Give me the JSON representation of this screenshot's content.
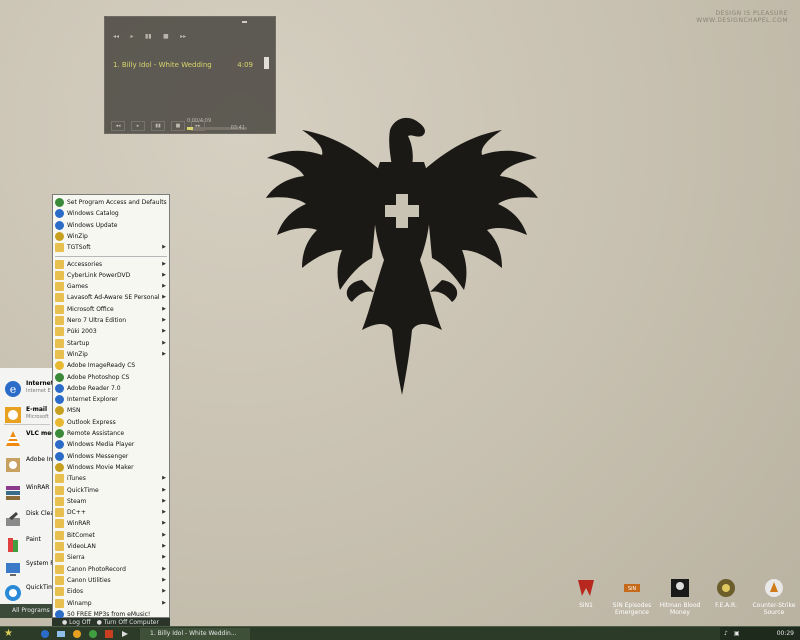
{
  "watermark": {
    "line1": "DESIGN IS PLEASURE",
    "line2": "WWW.DESIGNCHAPEL.COM"
  },
  "player": {
    "track": "1. Billy Idol - White Wedding",
    "duration": "4:09",
    "clock": "0:00/4:09",
    "remaining": "03:41",
    "progress": 0.1
  },
  "desktop_icons": [
    {
      "label": "SiN1"
    },
    {
      "label": "SiN Episodes Emergence"
    },
    {
      "label": "Hitman Blood Money"
    },
    {
      "label": "F.E.A.R."
    },
    {
      "label": "Counter-Strike Source"
    }
  ],
  "start_panel": {
    "items": [
      {
        "title": "Internet",
        "sub": "Internet E",
        "icon": "ie-icon"
      },
      {
        "title": "E-mail",
        "sub": "Microsoft",
        "icon": "email-icon"
      },
      {
        "title": "VLC media player",
        "sub": "",
        "icon": "vlc-icon"
      },
      {
        "title": "Adobe Ima CS",
        "sub": "",
        "icon": "imageready-icon"
      },
      {
        "title": "WinRAR",
        "sub": "",
        "icon": "winrar-icon"
      },
      {
        "title": "Disk Clean",
        "sub": "",
        "icon": "disk-cleanup-icon"
      },
      {
        "title": "Paint",
        "sub": "",
        "icon": "paint-icon"
      },
      {
        "title": "System R",
        "sub": "",
        "icon": "system-restore-icon"
      },
      {
        "title": "QuickTime",
        "sub": "",
        "icon": "quicktime-icon"
      }
    ],
    "all_programs": "All Programs"
  },
  "programs_menu": {
    "items": [
      {
        "label": "Set Program Access and Defaults",
        "sub": false
      },
      {
        "label": "Windows Catalog",
        "sub": false
      },
      {
        "label": "Windows Update",
        "sub": false
      },
      {
        "label": "WinZip",
        "sub": false
      },
      {
        "label": "TGTSoft",
        "sub": true
      },
      {
        "sep": true
      },
      {
        "label": "Accessories",
        "sub": true
      },
      {
        "label": "CyberLink PowerDVD",
        "sub": true
      },
      {
        "label": "Games",
        "sub": true
      },
      {
        "label": "Lavasoft Ad-Aware SE Personal",
        "sub": true
      },
      {
        "label": "Microsoft Office",
        "sub": true
      },
      {
        "label": "Nero 7 Ultra Edition",
        "sub": true
      },
      {
        "label": "Púki 2003",
        "sub": true
      },
      {
        "label": "Startup",
        "sub": true
      },
      {
        "label": "WinZip",
        "sub": true
      },
      {
        "label": "Adobe ImageReady CS",
        "sub": false
      },
      {
        "label": "Adobe Photoshop CS",
        "sub": false
      },
      {
        "label": "Adobe Reader 7.0",
        "sub": false
      },
      {
        "label": "Internet Explorer",
        "sub": false
      },
      {
        "label": "MSN",
        "sub": false
      },
      {
        "label": "Outlook Express",
        "sub": false
      },
      {
        "label": "Remote Assistance",
        "sub": false
      },
      {
        "label": "Windows Media Player",
        "sub": false
      },
      {
        "label": "Windows Messenger",
        "sub": false
      },
      {
        "label": "Windows Movie Maker",
        "sub": false
      },
      {
        "label": "iTunes",
        "sub": true
      },
      {
        "label": "QuickTime",
        "sub": true
      },
      {
        "label": "Steam",
        "sub": true
      },
      {
        "label": "DC++",
        "sub": true
      },
      {
        "label": "WinRAR",
        "sub": true
      },
      {
        "label": "BitComet",
        "sub": true
      },
      {
        "label": "VideoLAN",
        "sub": true
      },
      {
        "label": "Sierra",
        "sub": true
      },
      {
        "label": "Canon PhotoRecord",
        "sub": true
      },
      {
        "label": "Canon Utilities",
        "sub": true
      },
      {
        "label": "Eidos",
        "sub": true
      },
      {
        "label": "Winamp",
        "sub": true
      },
      {
        "label": "50 FREE MP3s from eMusic!",
        "sub": false
      }
    ]
  },
  "start_bottom": {
    "logoff": "Log Off",
    "turnoff": "Turn Off Computer"
  },
  "taskbar": {
    "task": "1. Billy Idol - White Weddin...",
    "clock": "00:29"
  },
  "colors": {
    "taskbar": "#2b3b28",
    "accent": "#d9d56c",
    "menu_bg": "#f7f7f2"
  }
}
